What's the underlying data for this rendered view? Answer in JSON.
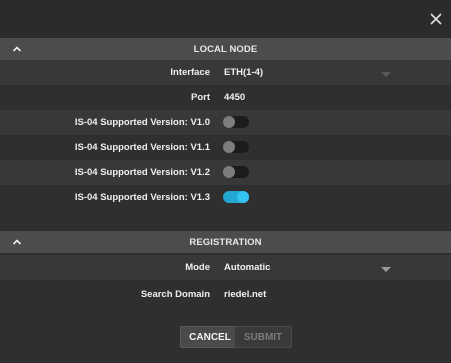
{
  "dialog": {
    "close_icon": "close-icon"
  },
  "local_node": {
    "title": "LOCAL NODE",
    "interface": {
      "label": "Interface",
      "value": "ETH(1-4)"
    },
    "port": {
      "label": "Port",
      "value": "4450"
    },
    "versions": [
      {
        "label": "IS-04 Supported Version: V1.0",
        "enabled": false
      },
      {
        "label": "IS-04 Supported Version: V1.1",
        "enabled": false
      },
      {
        "label": "IS-04 Supported Version: V1.2",
        "enabled": false
      },
      {
        "label": "IS-04 Supported Version: V1.3",
        "enabled": true
      }
    ]
  },
  "registration": {
    "title": "REGISTRATION",
    "mode": {
      "label": "Mode",
      "value": "Automatic"
    },
    "search_domain": {
      "label": "Search Domain",
      "value": "riedel.net"
    }
  },
  "buttons": {
    "cancel": "CANCEL",
    "submit": "SUBMIT"
  },
  "colors": {
    "toggle_on": "#22a7d2",
    "header_bg": "#4c4c4c"
  }
}
